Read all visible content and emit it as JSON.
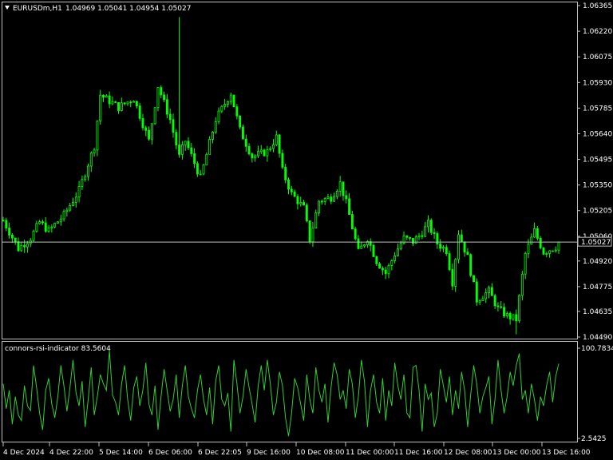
{
  "header": {
    "symbol": "EURUSDm,H1",
    "ohlc": "1.04969 1.05041 1.04954 1.05027"
  },
  "indicator": {
    "label": "connors-rsi-indicator 83.5604"
  },
  "colors": {
    "background": "#000000",
    "candle": "#00ff00",
    "indicator_line": "#32cd32",
    "frame": "#c0c0c0",
    "price_line": "#c0c0c0",
    "text": "#ffffff"
  },
  "chart_data": [
    {
      "type": "candlestick",
      "title": "EURUSDm,H1",
      "current_price": 1.05027,
      "current_price_label": "1.05027",
      "ylim": [
        1.0449,
        1.06365
      ],
      "y_ticks": [
        "1.06365",
        "1.06220",
        "1.06075",
        "1.05930",
        "1.05785",
        "1.05640",
        "1.05495",
        "1.05350",
        "1.05205",
        "1.05060",
        "1.04920",
        "1.04775",
        "1.04635",
        "1.04490"
      ],
      "y_tick_values": [
        1.06365,
        1.0622,
        1.06075,
        1.0593,
        1.05785,
        1.0564,
        1.05495,
        1.0535,
        1.05205,
        1.0506,
        1.0492,
        1.04775,
        1.04635,
        1.0449
      ],
      "x_ticks": [
        "4 Dec 2024",
        "4 Dec 22:00",
        "5 Dec 14:00",
        "6 Dec 06:00",
        "6 Dec 22:05",
        "9 Dec 16:00",
        "10 Dec 08:00",
        "11 Dec 00:00",
        "11 Dec 16:00",
        "12 Dec 08:00",
        "13 Dec 00:00",
        "13 Dec 16:00"
      ],
      "close_keypoints": [
        [
          0,
          1.0515
        ],
        [
          5,
          1.0499
        ],
        [
          9,
          1.0505
        ],
        [
          12,
          1.0514
        ],
        [
          15,
          1.0509
        ],
        [
          20,
          1.0518
        ],
        [
          25,
          1.0532
        ],
        [
          30,
          1.0557
        ],
        [
          32,
          1.0586
        ],
        [
          38,
          1.0579
        ],
        [
          43,
          1.0584
        ],
        [
          48,
          1.056
        ],
        [
          51,
          1.0591
        ],
        [
          55,
          1.0572
        ],
        [
          58,
          1.0551
        ],
        [
          60,
          1.056
        ],
        [
          65,
          1.0539
        ],
        [
          70,
          1.0572
        ],
        [
          75,
          1.0587
        ],
        [
          78,
          1.0566
        ],
        [
          82,
          1.0551
        ],
        [
          87,
          1.0554
        ],
        [
          90,
          1.0562
        ],
        [
          92,
          1.0543
        ],
        [
          95,
          1.053
        ],
        [
          99,
          1.0522
        ],
        [
          101,
          1.0504
        ],
        [
          104,
          1.0526
        ],
        [
          108,
          1.0528
        ],
        [
          111,
          1.0536
        ],
        [
          113,
          1.0525
        ],
        [
          117,
          1.0497
        ],
        [
          120,
          1.0505
        ],
        [
          123,
          1.0492
        ],
        [
          126,
          1.0485
        ],
        [
          129,
          1.0496
        ],
        [
          132,
          1.0505
        ],
        [
          135,
          1.0503
        ],
        [
          138,
          1.0508
        ],
        [
          140,
          1.0513
        ],
        [
          143,
          1.0502
        ],
        [
          146,
          1.0498
        ],
        [
          148,
          1.048
        ],
        [
          150,
          1.0508
        ],
        [
          153,
          1.0494
        ],
        [
          156,
          1.047
        ],
        [
          160,
          1.0475
        ],
        [
          163,
          1.0465
        ],
        [
          166,
          1.0461
        ],
        [
          169,
          1.0459
        ],
        [
          172,
          1.0496
        ],
        [
          175,
          1.0509
        ],
        [
          178,
          1.0497
        ],
        [
          182,
          1.05
        ],
        [
          183,
          1.05027
        ]
      ],
      "candle_count": 184
    },
    {
      "type": "line",
      "title": "connors-rsi-indicator",
      "current_value": 83.5604,
      "ylim": [
        2.5425,
        100.7834
      ],
      "y_ticks": [
        "100.7834",
        "2.5425"
      ],
      "y_tick_values": [
        100.7834,
        2.5425
      ],
      "values": [
        62,
        35,
        55,
        18,
        48,
        28,
        22,
        60,
        38,
        33,
        82,
        58,
        30,
        12,
        55,
        68,
        40,
        25,
        48,
        82,
        60,
        32,
        58,
        88,
        52,
        38,
        65,
        15,
        45,
        80,
        28,
        48,
        72,
        62,
        55,
        98,
        50,
        42,
        28,
        62,
        82,
        45,
        22,
        58,
        70,
        38,
        55,
        85,
        40,
        28,
        60,
        12,
        48,
        78,
        55,
        32,
        45,
        72,
        25,
        60,
        82,
        48,
        35,
        25,
        55,
        72,
        45,
        28,
        58,
        18,
        65,
        82,
        45,
        38,
        52,
        10,
        88,
        62,
        30,
        48,
        78,
        58,
        40,
        20,
        60,
        82,
        55,
        88,
        62,
        28,
        42,
        75,
        60,
        25,
        5,
        30,
        68,
        58,
        40,
        22,
        72,
        45,
        30,
        80,
        55,
        42,
        62,
        20,
        58,
        85,
        72,
        45,
        55,
        35,
        78,
        62,
        25,
        48,
        88,
        65,
        15,
        55,
        72,
        42,
        30,
        68,
        22,
        55,
        38,
        85,
        60,
        45,
        72,
        30,
        25,
        80,
        82,
        55,
        10,
        62,
        45,
        52,
        15,
        30,
        78,
        60,
        42,
        70,
        28,
        55,
        35,
        75,
        55,
        15,
        50,
        82,
        62,
        30,
        48,
        58,
        70,
        18,
        45,
        88,
        55,
        30,
        48,
        75,
        60,
        82,
        95,
        45,
        55,
        30,
        62,
        45,
        22,
        48,
        38,
        60,
        75,
        42,
        70,
        84
      ]
    }
  ]
}
